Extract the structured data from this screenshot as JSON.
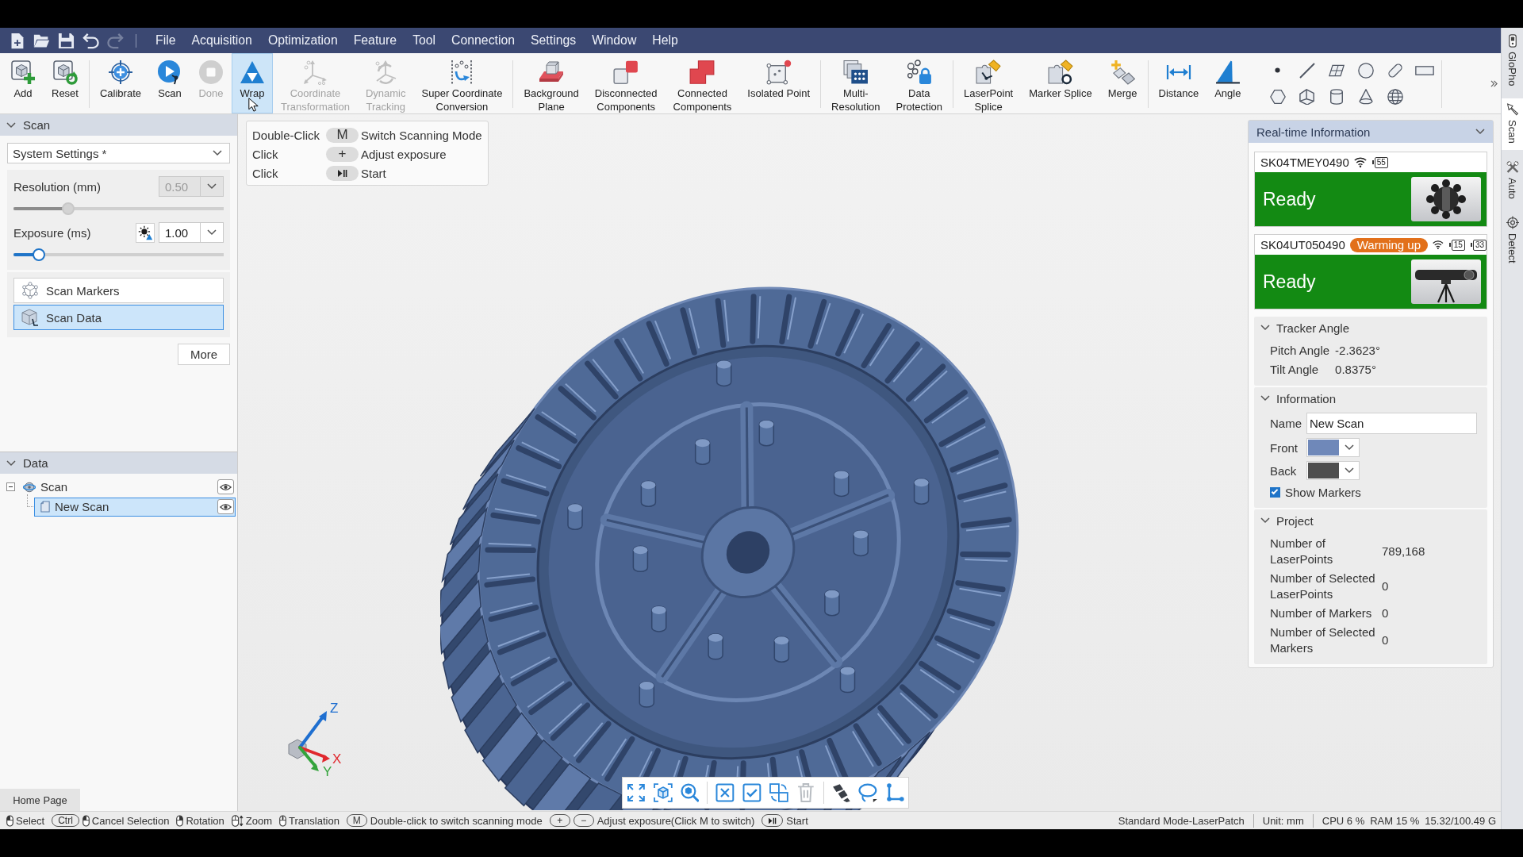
{
  "quick_access": [
    {
      "kind": "new",
      "disabled": false
    },
    {
      "kind": "open",
      "disabled": false
    },
    {
      "kind": "save",
      "disabled": false
    },
    {
      "kind": "undo",
      "disabled": false
    },
    {
      "kind": "redo",
      "disabled": true
    }
  ],
  "menu": [
    {
      "label": "File"
    },
    {
      "label": "Acquisition"
    },
    {
      "label": "Optimization"
    },
    {
      "label": "Feature"
    },
    {
      "label": "Tool"
    },
    {
      "label": "Connection"
    },
    {
      "label": "Settings"
    },
    {
      "label": "Window"
    },
    {
      "label": "Help"
    }
  ],
  "ribbon": {
    "groups": [
      {
        "buttons": [
          {
            "kind": "add",
            "label": "Add",
            "disabled": false,
            "hovered": false
          },
          {
            "kind": "reset",
            "label": "Reset",
            "disabled": false,
            "hovered": false
          }
        ]
      },
      {
        "buttons": [
          {
            "kind": "calibrate",
            "label": "Calibrate",
            "disabled": false,
            "hovered": false
          },
          {
            "kind": "scan",
            "label": "Scan",
            "disabled": false,
            "hovered": false
          },
          {
            "kind": "done",
            "label": "Done",
            "disabled": true,
            "hovered": false
          },
          {
            "kind": "wrap",
            "label": "Wrap",
            "disabled": false,
            "hovered": true
          },
          {
            "kind": "coordinate-transformation",
            "label": "Coordinate\nTransformation",
            "disabled": true,
            "hovered": false
          },
          {
            "kind": "dynamic-tracking",
            "label": "Dynamic\nTracking",
            "disabled": true,
            "hovered": false
          },
          {
            "kind": "super-coordinate-conversion",
            "label": "Super Coordinate\nConversion",
            "disabled": false,
            "hovered": false
          }
        ]
      },
      {
        "buttons": [
          {
            "kind": "background-plane",
            "label": "Background\nPlane",
            "disabled": false,
            "hovered": false
          },
          {
            "kind": "disconnected-components",
            "label": "Disconnected\nComponents",
            "disabled": false,
            "hovered": false
          },
          {
            "kind": "connected-components",
            "label": "Connected\nComponents",
            "disabled": false,
            "hovered": false
          },
          {
            "kind": "isolated-point",
            "label": "Isolated Point",
            "disabled": false,
            "hovered": false
          }
        ]
      },
      {
        "buttons": [
          {
            "kind": "multi-resolution",
            "label": "Multi-\nResolution",
            "disabled": false,
            "hovered": false
          },
          {
            "kind": "data-protection",
            "label": "Data\nProtection",
            "disabled": false,
            "hovered": false
          }
        ]
      },
      {
        "buttons": [
          {
            "kind": "laserpoint-splice",
            "label": "LaserPoint\nSplice",
            "disabled": false,
            "hovered": false
          },
          {
            "kind": "marker-splice",
            "label": "Marker Splice",
            "disabled": false,
            "hovered": false
          },
          {
            "kind": "merge",
            "label": "Merge",
            "disabled": false,
            "hovered": false
          }
        ]
      },
      {
        "buttons": [
          {
            "kind": "distance",
            "label": "Distance",
            "disabled": false,
            "hovered": false
          },
          {
            "kind": "angle",
            "label": "Angle",
            "disabled": false,
            "hovered": false
          }
        ]
      }
    ],
    "shape_tools": [
      {
        "kind": "point"
      },
      {
        "kind": "line"
      },
      {
        "kind": "plane"
      },
      {
        "kind": "circle"
      },
      {
        "kind": "slot"
      },
      {
        "kind": "rectangle"
      },
      {
        "kind": "polygon"
      },
      {
        "kind": "corner"
      },
      {
        "kind": "cylinder"
      },
      {
        "kind": "cone"
      },
      {
        "kind": "sphere"
      }
    ]
  },
  "scan_panel": {
    "title": "Scan",
    "expanded": true,
    "preset": "System Settings *",
    "resolution": {
      "label": "Resolution (mm)",
      "value": "0.50",
      "disabled": true,
      "level": 0.26
    },
    "exposure": {
      "label": "Exposure (ms)",
      "value": "1.00",
      "disabled": false,
      "level": 0.12
    },
    "modes": [
      {
        "kind": "markers",
        "label": "Scan Markers",
        "selected": false
      },
      {
        "kind": "data",
        "label": "Scan Data",
        "selected": true
      }
    ],
    "more_button": "More"
  },
  "data_panel": {
    "title": "Data",
    "expanded": true,
    "tree": [
      {
        "kind": "group",
        "label": "Scan",
        "expanded": true,
        "selected": false,
        "visible": true,
        "children": [
          {
            "kind": "scan",
            "label": "New Scan",
            "selected": true,
            "visible": true
          }
        ]
      }
    ]
  },
  "page_tabs": [
    {
      "label": "Home Page",
      "selected": true
    }
  ],
  "viewport": {
    "hints": [
      {
        "action": "Double-Click",
        "kind": "text",
        "key": "M",
        "description": "Switch Scanning Mode"
      },
      {
        "action": "Click",
        "kind": "text",
        "key": "+",
        "description": "Adjust exposure"
      },
      {
        "action": "Click",
        "kind": "play-pause",
        "description": "Start"
      }
    ],
    "axes": [
      {
        "kind": "z",
        "label": "Z",
        "color": "#1f6fd0"
      },
      {
        "kind": "x",
        "label": "X",
        "color": "#e0282e"
      },
      {
        "kind": "y",
        "label": "Y",
        "color": "#34a43c"
      }
    ],
    "toolbar": [
      {
        "tools": [
          {
            "kind": "fit",
            "disabled": false
          },
          {
            "kind": "cube-view",
            "disabled": false
          },
          {
            "kind": "zoom",
            "disabled": false
          }
        ]
      },
      {
        "tools": [
          {
            "kind": "deselect",
            "disabled": false
          },
          {
            "kind": "select-all",
            "disabled": false
          },
          {
            "kind": "invert",
            "disabled": false
          },
          {
            "kind": "delete",
            "disabled": true
          }
        ]
      },
      {
        "tools": [
          {
            "kind": "brush",
            "disabled": false
          },
          {
            "kind": "lasso",
            "disabled": false
          },
          {
            "kind": "corner-points",
            "disabled": false
          }
        ]
      }
    ]
  },
  "realtime_panel": {
    "title": "Real-time Information",
    "expanded": true,
    "devices": [
      {
        "kind": "scanner",
        "serial": "SK04TMEY0490",
        "batteries": [
          "55"
        ],
        "status": "Ready"
      },
      {
        "kind": "tracker",
        "serial": "SK04UT050490",
        "badge": "Warming up",
        "batteries": [
          "15",
          "33"
        ],
        "status": "Ready"
      }
    ],
    "sections": [
      {
        "kind": "values",
        "title": "Tracker Angle",
        "expanded": true,
        "rows": [
          {
            "label": "Pitch Angle",
            "value": "-2.3623°"
          },
          {
            "label": "Tilt Angle",
            "value": "0.8375°"
          }
        ]
      },
      {
        "kind": "information",
        "title": "Information",
        "expanded": true,
        "name": {
          "label": "Name",
          "value": "New Scan"
        },
        "colors": [
          {
            "label": "Front",
            "color": "#6f88b9"
          },
          {
            "label": "Back",
            "color": "#4e4e4e"
          }
        ],
        "show_markers": {
          "label": "Show Markers",
          "checked": true
        }
      },
      {
        "kind": "values",
        "title": "Project",
        "expanded": true,
        "rows": [
          {
            "label": "Number of LaserPoints",
            "value": "789,168"
          },
          {
            "label": "Number of Selected LaserPoints",
            "value": "0"
          },
          {
            "label": "Number of Markers",
            "value": "0"
          },
          {
            "label": "Number of Selected Markers",
            "value": "0"
          }
        ]
      }
    ]
  },
  "side_tabs": [
    {
      "kind": "glopho",
      "label": "GloPho",
      "selected": false
    },
    {
      "kind": "scan",
      "label": "Scan",
      "selected": true
    },
    {
      "kind": "auto",
      "label": "Auto",
      "selected": false
    },
    {
      "kind": "detect",
      "label": "Detect",
      "selected": false
    }
  ],
  "status_bar": {
    "hints": [
      {
        "kind": "mouse-left",
        "label": "Select"
      },
      {
        "kind": "key-mouse",
        "keys": [
          "Ctrl"
        ],
        "label": "Cancel Selection"
      },
      {
        "kind": "mouse-right",
        "label": "Rotation"
      },
      {
        "kind": "mouse-wheel",
        "label": "Zoom"
      },
      {
        "kind": "mouse-middle",
        "label": "Translation"
      },
      {
        "kind": "keys",
        "keys": [
          "M"
        ],
        "label": "Double-click to switch scanning mode"
      },
      {
        "kind": "keys",
        "keys": [
          "+",
          "−"
        ],
        "label": "Adjust exposure(Click M to switch)"
      },
      {
        "kind": "play-pause",
        "label": "Start"
      }
    ],
    "info": [
      {
        "items": [
          "Standard Mode-LaserPatch"
        ]
      },
      {
        "items": [
          "Unit: mm"
        ]
      },
      {
        "items": [
          "CPU 6 %",
          "RAM 15 %",
          "15.32/100.49 G"
        ]
      }
    ]
  }
}
